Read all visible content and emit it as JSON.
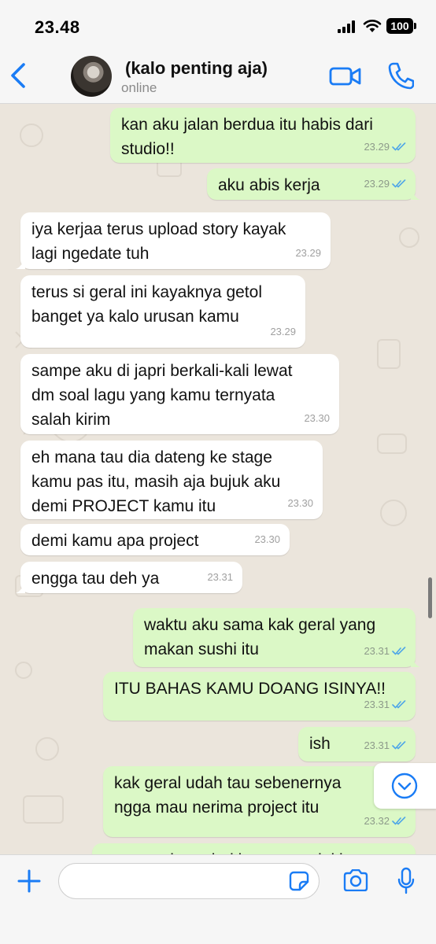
{
  "status_bar": {
    "time": "23.48",
    "battery": "100"
  },
  "header": {
    "contact_name": "(kalo penting aja)",
    "contact_status": "online"
  },
  "colors": {
    "accent": "#1a7cf5",
    "outgoing_bubble": "#dbf8c6",
    "incoming_bubble": "#ffffff",
    "read_ticks": "#4fa6e8"
  },
  "messages": [
    {
      "dir": "out",
      "lines": "kan aku jalan berdua itu habis dari\nstudio!!",
      "time": "23.29",
      "read": true
    },
    {
      "dir": "out",
      "lines": "aku abis kerja",
      "time": "23.29",
      "read": true
    },
    {
      "dir": "in",
      "lines": "iya kerjaa terus upload story kayak\nlagi ngedate tuh",
      "time": "23.29"
    },
    {
      "dir": "in",
      "lines": "terus si geral ini kayaknya getol\nbanget ya kalo urusan kamu",
      "time": "23.29"
    },
    {
      "dir": "in",
      "lines": "sampe aku di japri berkali-kali lewat\ndm soal lagu yang kamu ternyata\nsalah kirim",
      "time": "23.30"
    },
    {
      "dir": "in",
      "lines": "eh mana tau dia dateng ke stage\nkamu pas itu, masih aja bujuk aku\ndemi PROJECT kamu itu",
      "time": "23.30"
    },
    {
      "dir": "in",
      "lines": "demi kamu apa project",
      "time": "23.30"
    },
    {
      "dir": "in",
      "lines": "engga tau deh ya",
      "time": "23.31"
    },
    {
      "dir": "out",
      "lines": "waktu aku sama kak geral yang\nmakan sushi itu",
      "time": "23.31",
      "read": true
    },
    {
      "dir": "out",
      "lines": "ITU BAHAS KAMU DOANG ISINYA!!",
      "time": "23.31",
      "read": true
    },
    {
      "dir": "out",
      "lines": "ish",
      "time": "23.31",
      "read": true
    },
    {
      "dir": "out",
      "lines": "kak geral udah tau sebenernya\nngga mau nerima project itu",
      "time": "23.32",
      "read": true
    },
    {
      "dir": "out",
      "lines": "ya masa lagu dari kamu spesial buat",
      "time": "",
      "read": false
    }
  ],
  "composer": {
    "value": "",
    "placeholder": ""
  }
}
